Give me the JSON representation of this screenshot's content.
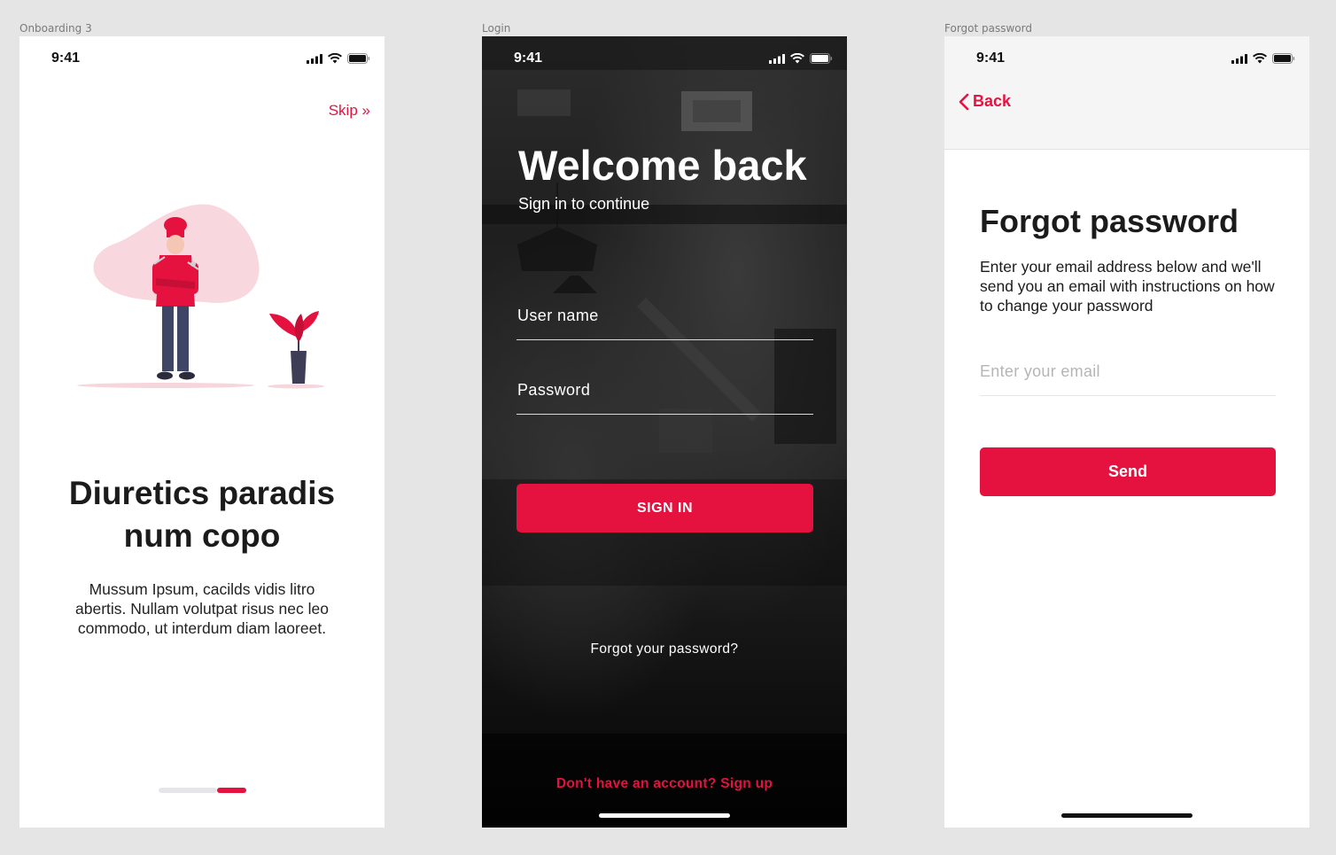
{
  "frames": {
    "onboarding": {
      "label": "Onboarding 3",
      "time": "9:41",
      "skip": "Skip",
      "title": "Diuretics paradis num copo",
      "body": "Mussum Ipsum, cacilds vidis litro abertis. Nullam volutpat risus nec leo commodo, ut interdum diam laoreet.",
      "pagination": {
        "pages": 2,
        "active_index": 1
      }
    },
    "login": {
      "label": "Login",
      "time": "9:41",
      "title": "Welcome back",
      "subtitle": "Sign in to continue",
      "username_placeholder": "User name",
      "password_placeholder": "Password",
      "signin_label": "SIGN IN",
      "forgot_label": "Forgot your password?",
      "signup_label": "Don't have an account? Sign up"
    },
    "forgot": {
      "label": "Forgot password",
      "time": "9:41",
      "back_label": "Back",
      "title": "Forgot password",
      "body": "Enter your email address below and we'll send you an email with instructions on how to change your password",
      "email_placeholder": "Enter your email",
      "send_label": "Send"
    }
  },
  "colors": {
    "accent": "#e5113f",
    "canvas": "#e5e5e5",
    "text_dark": "#1b1b1b",
    "header_bg": "#f5f5f5"
  },
  "icons": [
    "signal-icon",
    "wifi-icon",
    "battery-icon",
    "chevron-double-right-icon",
    "chevron-left-icon",
    "chef-illustration",
    "plant-illustration"
  ]
}
